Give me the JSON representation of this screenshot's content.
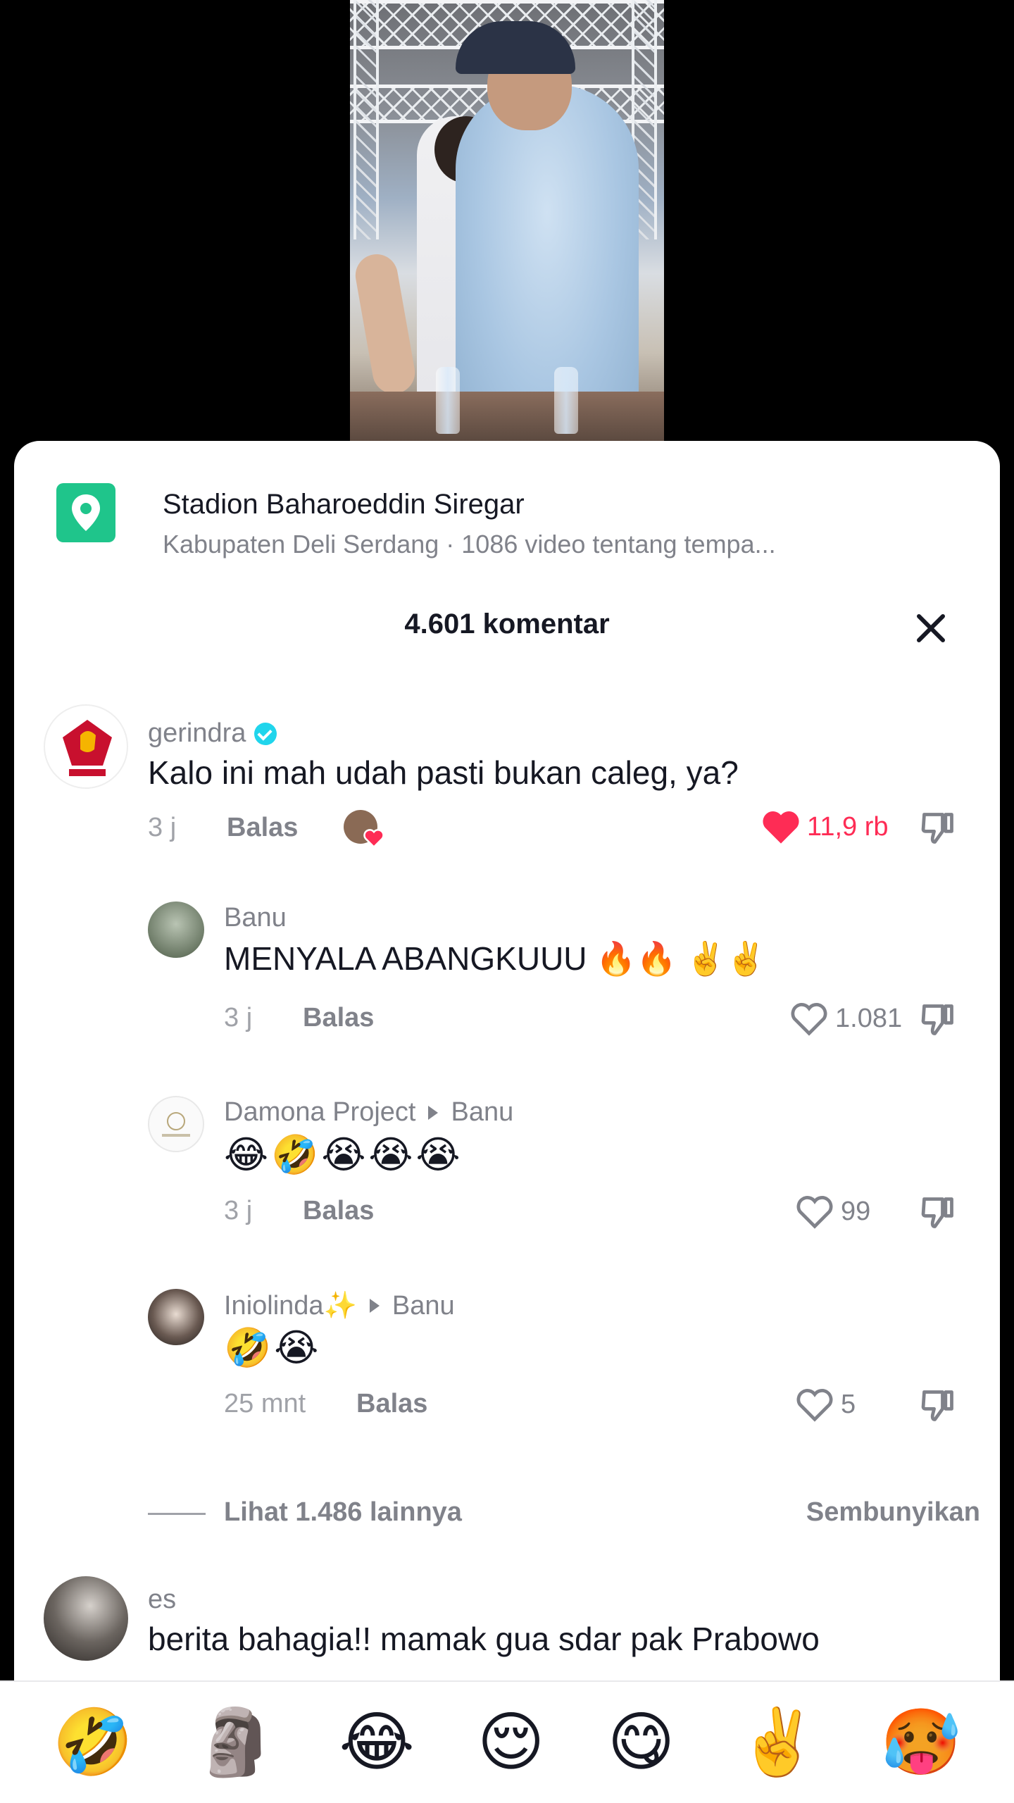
{
  "location": {
    "title": "Stadion Baharoeddin Siregar",
    "subtitle": "Kabupaten Deli Serdang · 1086 video tentang tempa..."
  },
  "comments_header": {
    "count": "4.601 komentar"
  },
  "comments": [
    {
      "username": "gerindra",
      "verified": true,
      "text": "Kalo ini mah udah pasti bukan caleg, ya?",
      "time": "3 j",
      "reply": "Balas",
      "likes": "11,9 rb",
      "liked": true
    },
    {
      "username": "Banu",
      "text": "MENYALA ABANGKUUU 🔥🔥 ✌️✌️",
      "time": "3 j",
      "reply": "Balas",
      "likes": "1.081"
    },
    {
      "username": "Damona Project",
      "reply_to": "Banu",
      "text": "😂🤣😭😭😭",
      "time": "3 j",
      "reply": "Balas",
      "likes": "99"
    },
    {
      "username": "Iniolinda✨",
      "reply_to": "Banu",
      "text": "🤣😭",
      "time": "25 mnt",
      "reply": "Balas",
      "likes": "5"
    },
    {
      "username": "es",
      "text": "berita bahagia!! mamak gua sdar pak Prabowo"
    }
  ],
  "more_replies": {
    "view_more": "Lihat 1.486 lainnya",
    "hide": "Sembunyikan"
  },
  "emoji_bar": [
    "🤣",
    "🗿",
    "😂",
    "😌",
    "😋",
    "✌️",
    "🥵"
  ],
  "colors": {
    "accent_like": "#fe2c55",
    "location_icon": "#1fc58b",
    "verified": "#20d5ec"
  }
}
